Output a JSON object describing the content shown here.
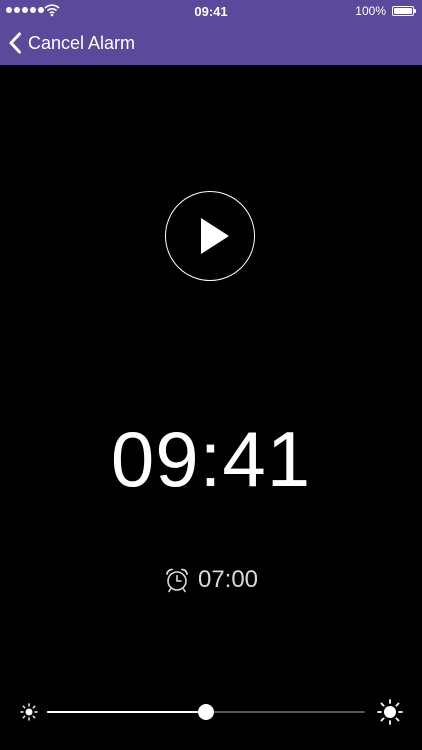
{
  "status_bar": {
    "time": "09:41",
    "battery_percent": "100%",
    "signal_icon": "signal-dots-icon",
    "wifi_icon": "wifi-icon",
    "battery_icon": "battery-icon"
  },
  "nav": {
    "back_label": "Cancel Alarm",
    "back_icon": "chevron-left-icon"
  },
  "player": {
    "play_icon": "play-icon"
  },
  "clock": {
    "time": "09:41"
  },
  "alarm": {
    "icon": "alarm-clock-icon",
    "time": "07:00"
  },
  "brightness": {
    "level": 0.5,
    "min_icon": "sun-small-icon",
    "max_icon": "sun-large-icon"
  },
  "colors": {
    "accent": "#5b4a9b",
    "background": "#000000",
    "text": "#ffffff",
    "secondary_text": "#d9d9d9"
  }
}
